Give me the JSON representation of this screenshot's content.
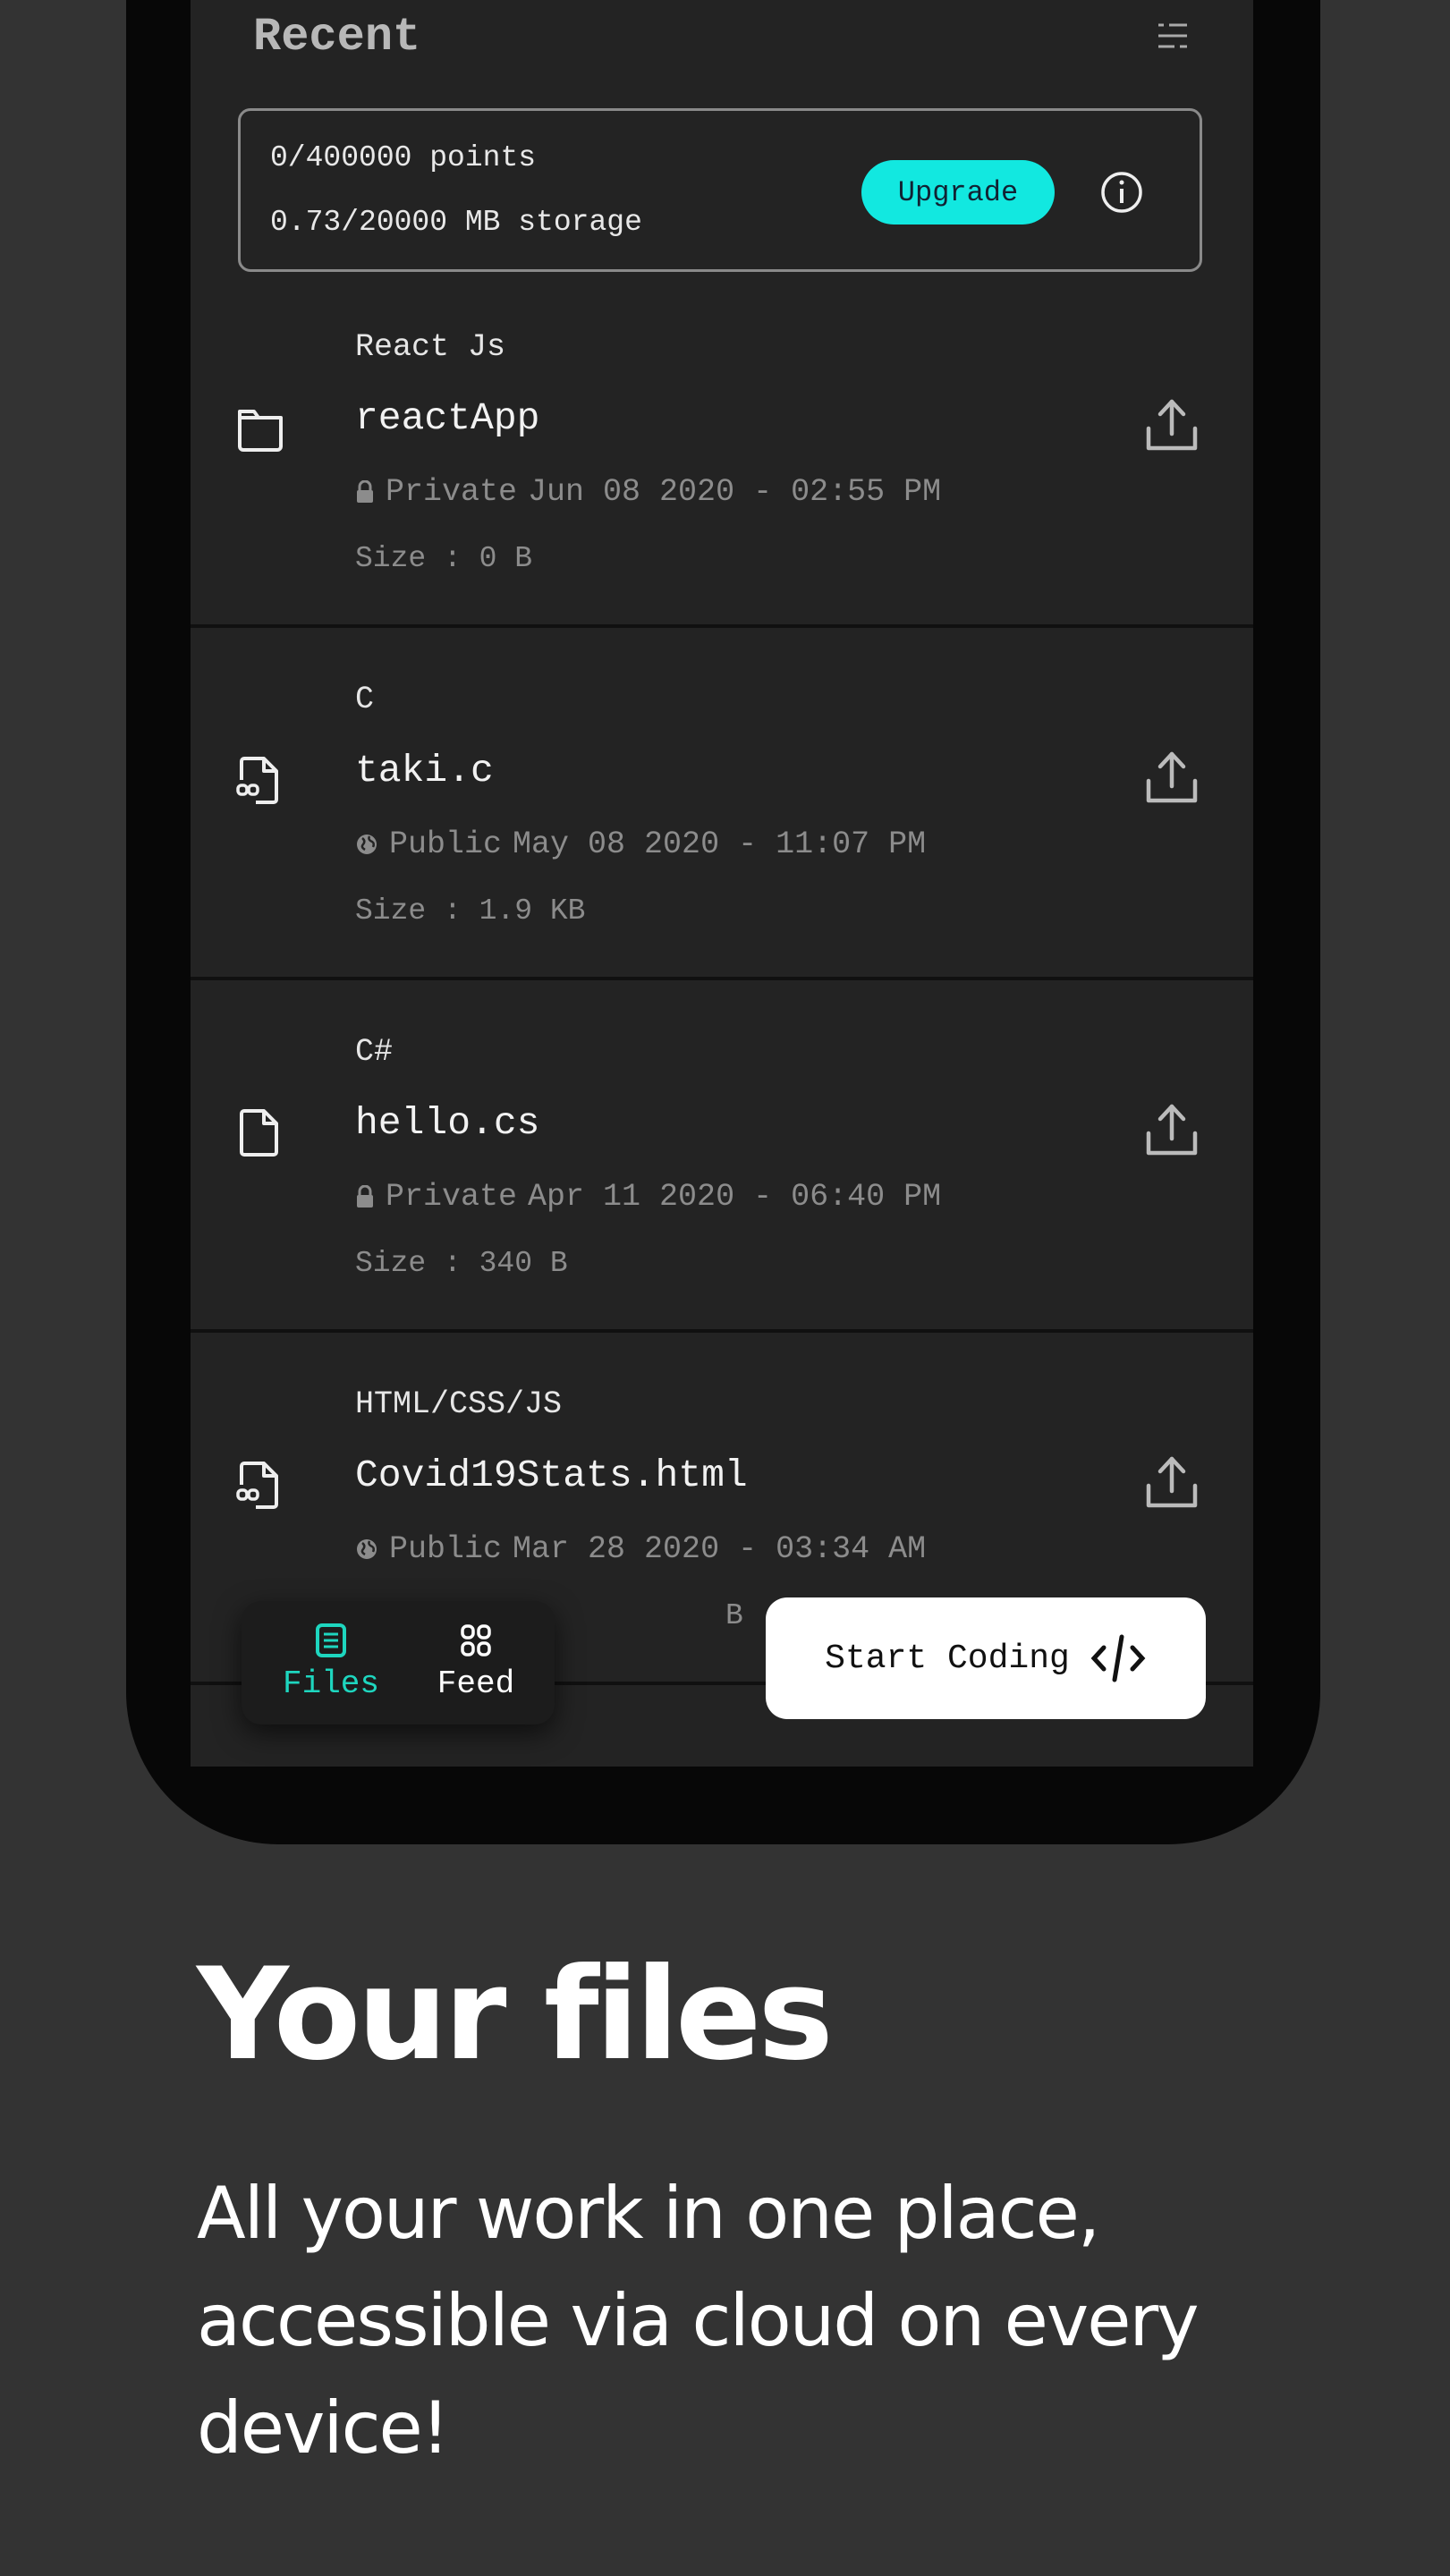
{
  "header": {
    "title": "Recent",
    "sort_icon": "sort-lines-icon"
  },
  "usage": {
    "points": "0/400000 points",
    "storage": "0.73/20000 MB storage",
    "upgrade_label": "Upgrade",
    "info_icon": "info-circle-icon",
    "accent": "#12e8e0"
  },
  "files": [
    {
      "category": "React Js",
      "name": "reactApp",
      "visibility": "Private",
      "date": "Jun 08 2020 - 02:55 PM",
      "size": "Size : 0 B",
      "icon": "folder-icon"
    },
    {
      "category": "C",
      "name": "taki.c",
      "visibility": "Public",
      "date": "May 08 2020 - 11:07 PM",
      "size": "Size : 1.9 KB",
      "icon": "code-file-icon"
    },
    {
      "category": "C#",
      "name": "hello.cs",
      "visibility": "Private",
      "date": "Apr 11 2020 - 06:40 PM",
      "size": "Size : 340 B",
      "icon": "file-icon"
    },
    {
      "category": "HTML/CSS/JS",
      "name": "Covid19Stats.html",
      "visibility": "Public",
      "date": "Mar 28 2020 - 03:34 AM",
      "size": "B",
      "icon": "code-file-icon"
    }
  ],
  "nav": {
    "files_label": "Files",
    "feed_label": "Feed",
    "active": "Files"
  },
  "start_coding_label": "Start Coding",
  "promo": {
    "title": "Your files",
    "body": "All your work in one place, accessible via cloud on every device!"
  }
}
